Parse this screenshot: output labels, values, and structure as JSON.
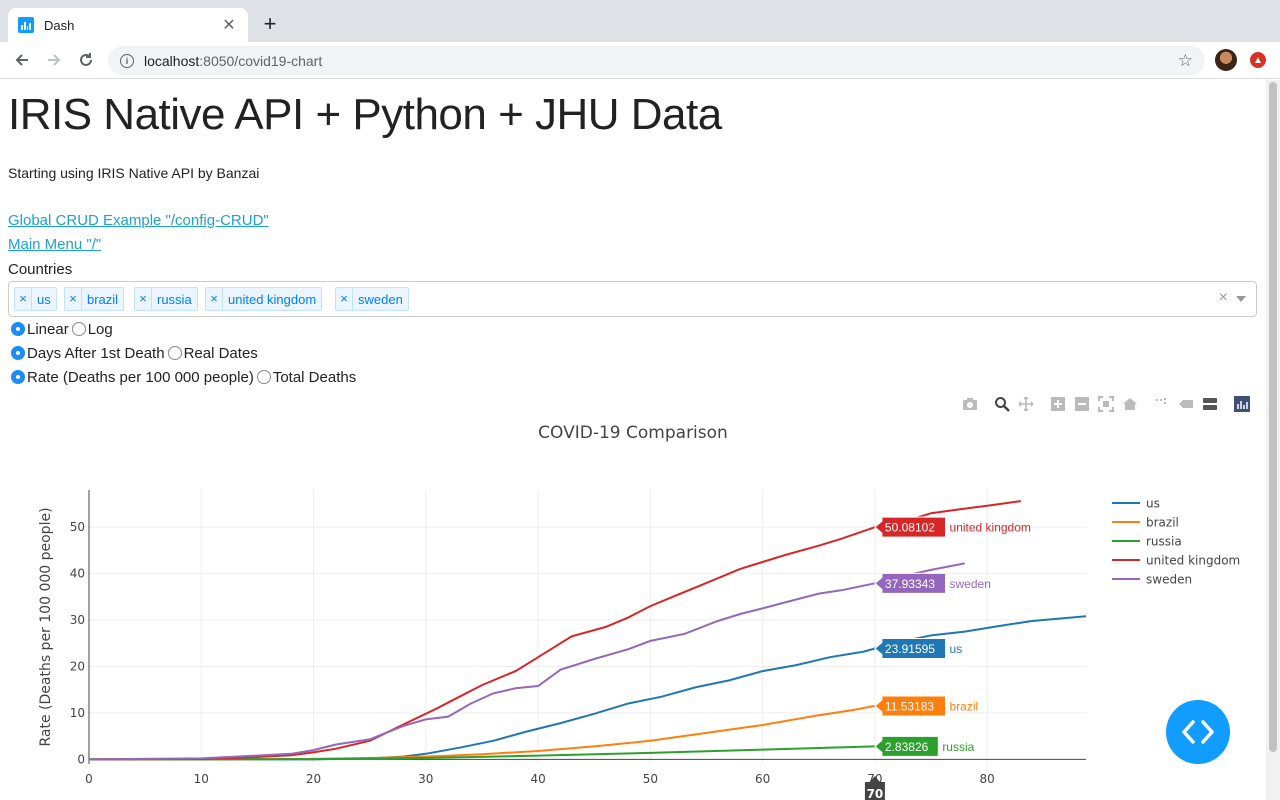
{
  "browser": {
    "tab_title": "Dash",
    "url_host": "localhost",
    "url_rest": ":8050/covid19-chart"
  },
  "page": {
    "title": "IRIS Native API + Python + JHU Data",
    "subtitle": "Starting using IRIS Native API by Banzai",
    "links": [
      "Global CRUD Example \"/config-CRUD\"",
      "Main Menu \"/\""
    ],
    "countries_label": "Countries",
    "selected_countries": [
      "us",
      "brazil",
      "russia",
      "united kingdom",
      "sweden"
    ],
    "radio_groups": [
      {
        "options": [
          "Linear",
          "Log"
        ],
        "selected": "Linear"
      },
      {
        "options": [
          "Days After 1st Death",
          "Real Dates"
        ],
        "selected": "Days After 1st Death"
      },
      {
        "options": [
          "Rate (Deaths per 100 000 people)",
          "Total Deaths"
        ],
        "selected": "Rate (Deaths per 100 000 people)"
      }
    ],
    "modebar_icons": [
      "camera-icon",
      "zoom-icon",
      "pan-icon",
      "zoom-in-icon",
      "zoom-out-icon",
      "autoscale-icon",
      "reset-axes-icon",
      "spike-lines-icon",
      "hover-closest-icon",
      "hover-compare-icon",
      "plotly-logo-icon"
    ]
  },
  "chart_data": {
    "type": "line",
    "title": "COVID-19 Comparison",
    "xlabel": "",
    "ylabel": "Rate (Deaths per 100 000 people)",
    "xlim": [
      0,
      88.8
    ],
    "ylim": [
      -1,
      58
    ],
    "xticks": [
      0,
      10,
      20,
      30,
      40,
      50,
      60,
      70,
      80
    ],
    "yticks": [
      0,
      10,
      20,
      30,
      40,
      50
    ],
    "grid": true,
    "legend_position": "top-right",
    "hover_x": 70,
    "series": [
      {
        "name": "us",
        "color": "#1f77b4",
        "hover_value": "23.91595",
        "x": [
          0,
          10,
          20,
          25,
          28,
          30,
          33,
          36,
          39,
          42,
          45,
          48,
          51,
          54,
          57,
          60,
          63,
          66,
          69,
          72,
          75,
          78,
          81,
          84,
          88.8
        ],
        "y": [
          0,
          0,
          0,
          0.2,
          0.6,
          1.2,
          2.5,
          4,
          6,
          7.8,
          9.8,
          12,
          13.5,
          15.5,
          17,
          19,
          20.3,
          22,
          23.2,
          25.2,
          26.7,
          27.5,
          28.7,
          29.8,
          30.8
        ]
      },
      {
        "name": "brazil",
        "color": "#ff7f0e",
        "hover_value": "11.53183",
        "x": [
          0,
          10,
          20,
          25,
          30,
          35,
          40,
          45,
          50,
          55,
          60,
          65,
          68,
          70
        ],
        "y": [
          0,
          0,
          0.1,
          0.3,
          0.6,
          1.1,
          1.8,
          2.8,
          4,
          5.7,
          7.4,
          9.5,
          10.6,
          11.5
        ]
      },
      {
        "name": "russia",
        "color": "#2ca02c",
        "hover_value": "2.83826",
        "x": [
          0,
          10,
          20,
          30,
          40,
          50,
          60,
          70
        ],
        "y": [
          0,
          0,
          0.05,
          0.3,
          0.8,
          1.4,
          2.1,
          2.8
        ]
      },
      {
        "name": "united kingdom",
        "color": "#d62728",
        "hover_value": "50.08102",
        "x": [
          0,
          10,
          15,
          18,
          20,
          22,
          25,
          28,
          31,
          33,
          35,
          38,
          40,
          43,
          46,
          48,
          50,
          52,
          55,
          58,
          60,
          62,
          65,
          67,
          70,
          73,
          75,
          78,
          80,
          83
        ],
        "y": [
          0,
          0.1,
          0.5,
          0.9,
          1.5,
          2.3,
          4,
          7.5,
          11,
          13.5,
          16,
          19,
          22,
          26.5,
          28.5,
          30.5,
          33,
          35,
          38,
          41,
          42.5,
          44,
          46,
          47.5,
          50,
          51.5,
          53,
          54,
          54.6,
          55.6
        ]
      },
      {
        "name": "sweden",
        "color": "#9467bd",
        "hover_value": "37.93343",
        "x": [
          0,
          10,
          14,
          18,
          20,
          22,
          25,
          28,
          30,
          32,
          34,
          36,
          38,
          40,
          42,
          45,
          48,
          50,
          53,
          56,
          58,
          60,
          62,
          65,
          67,
          70,
          72,
          75,
          78
        ],
        "y": [
          0,
          0.2,
          0.7,
          1.2,
          2,
          3.2,
          4.3,
          7.2,
          8.6,
          9.2,
          12,
          14.2,
          15.3,
          15.8,
          19.3,
          21.6,
          23.7,
          25.5,
          27,
          29.8,
          31.3,
          32.5,
          33.8,
          35.7,
          36.4,
          37.9,
          39.2,
          40.8,
          42.2
        ]
      }
    ]
  }
}
